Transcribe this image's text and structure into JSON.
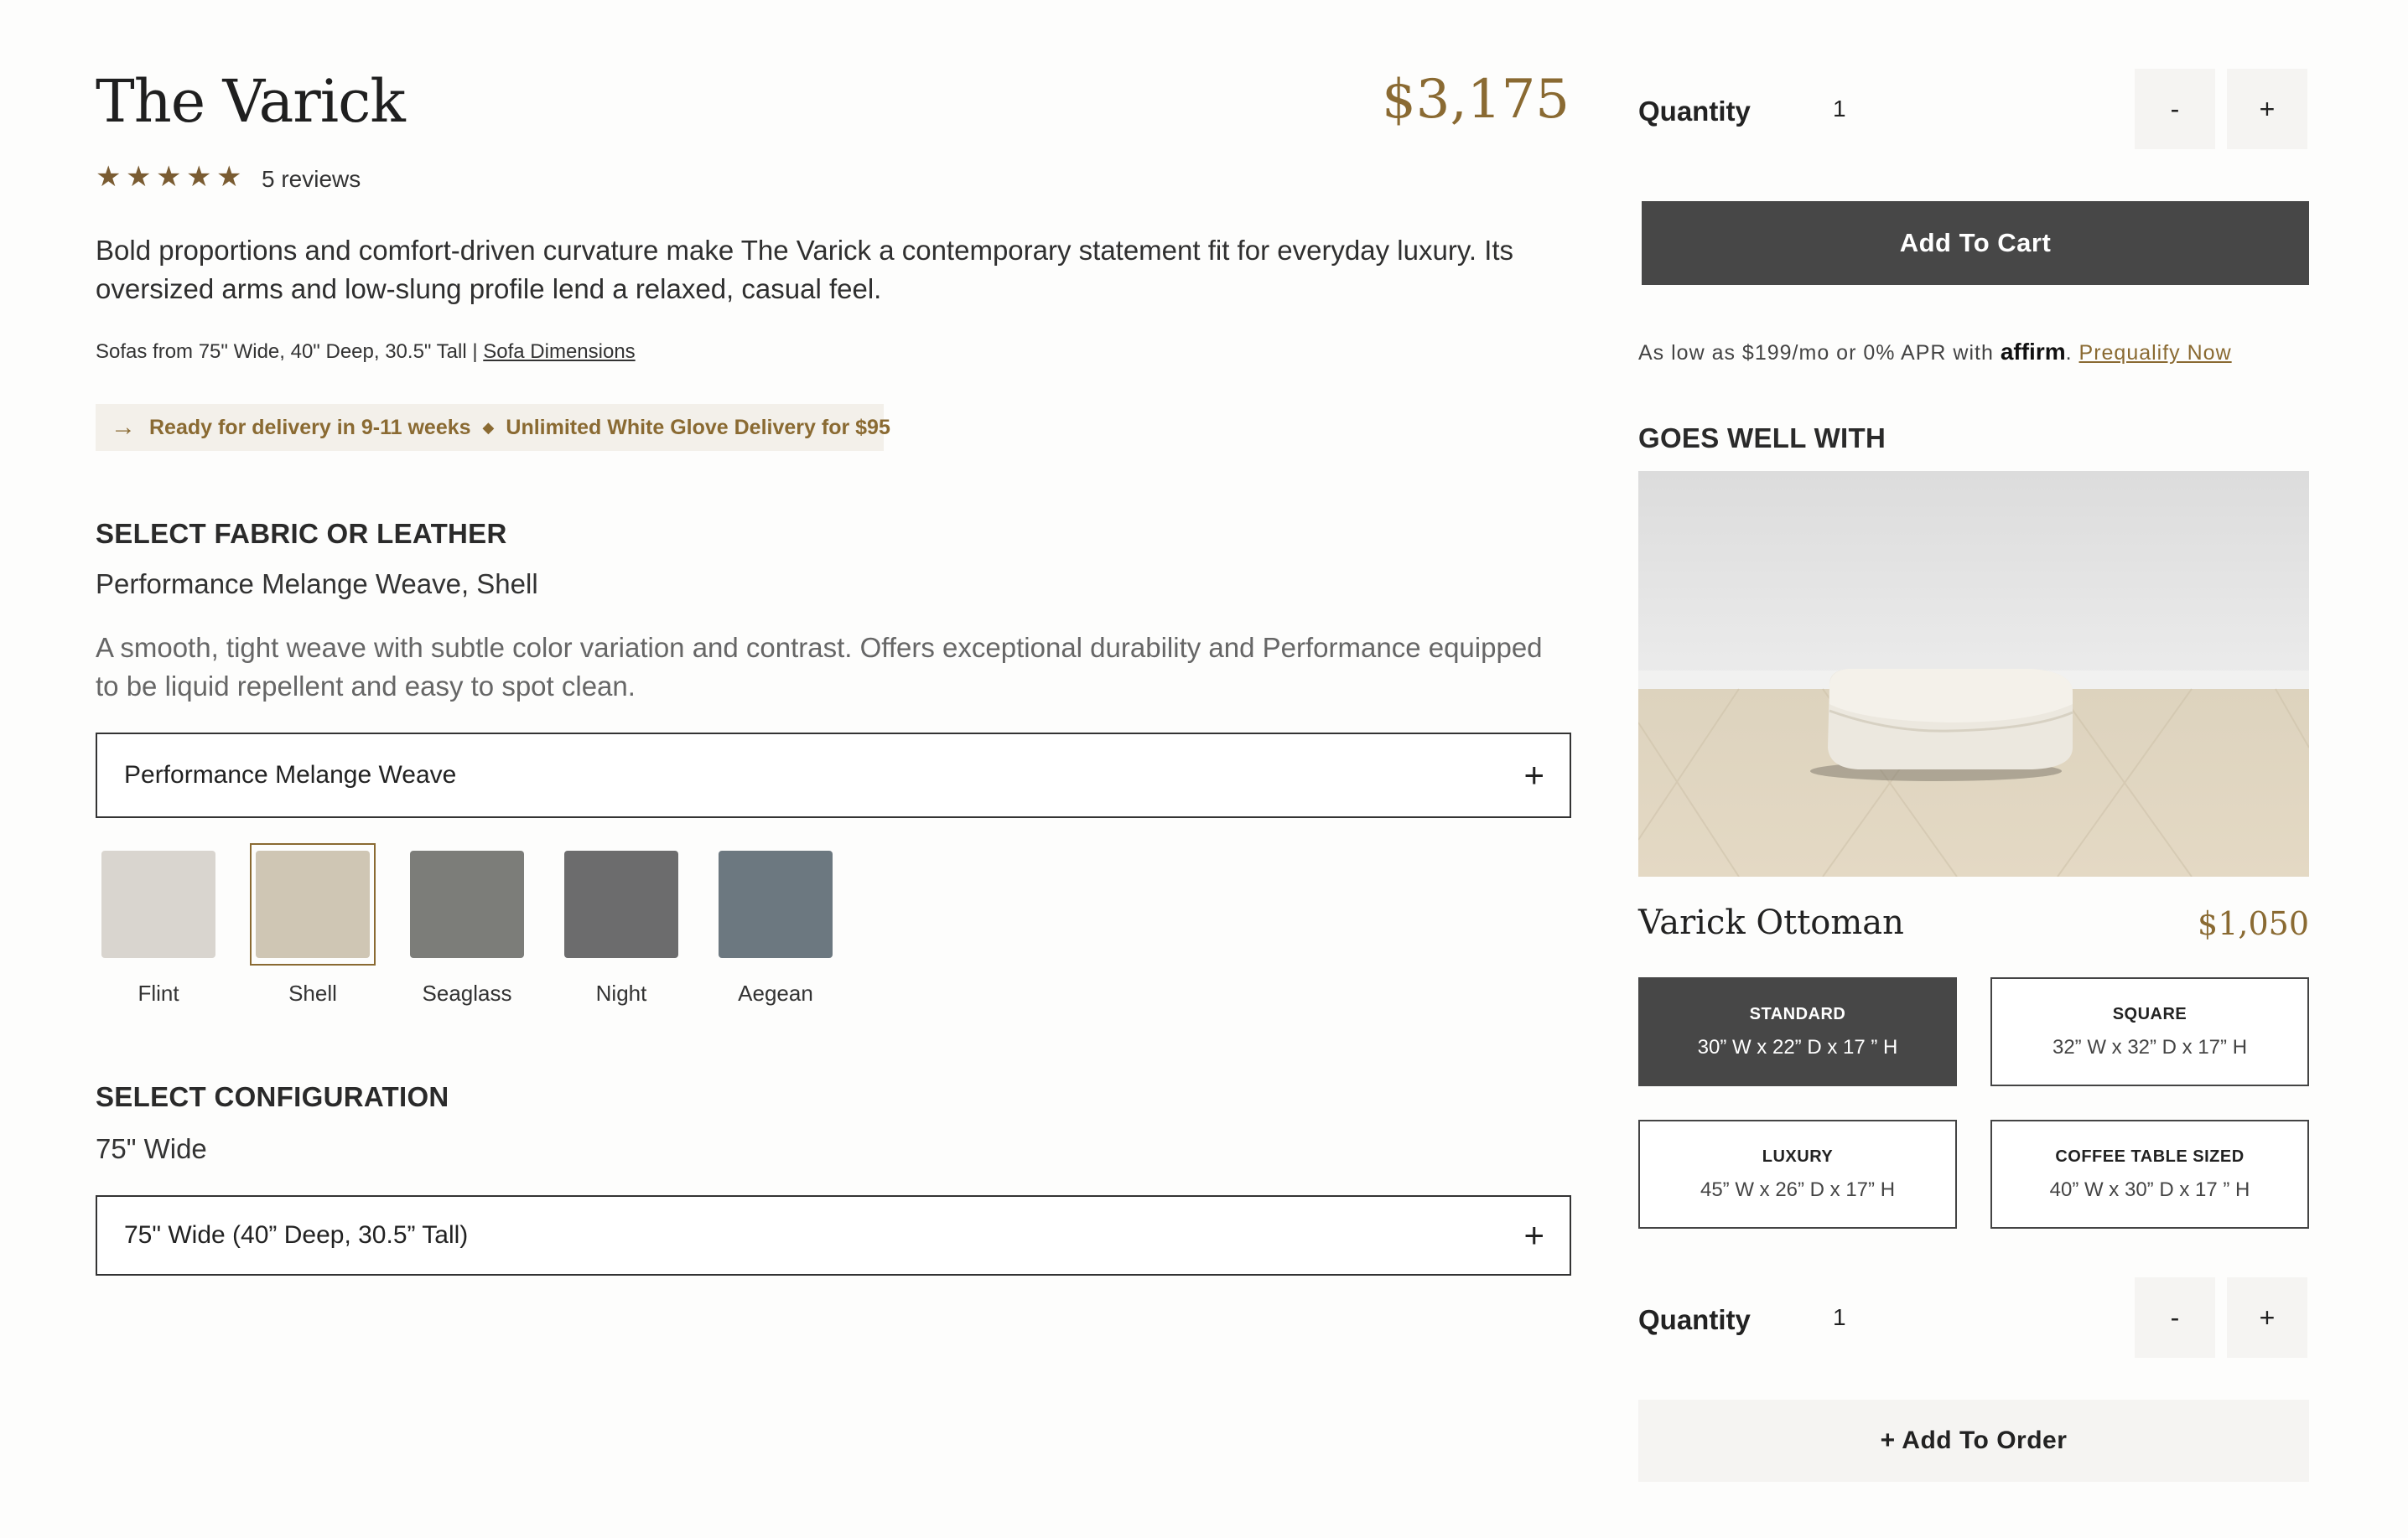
{
  "product": {
    "title": "The Varick",
    "price": "$3,175",
    "reviews": "5 reviews",
    "rating": 5,
    "description": "Bold proportions and comfort-driven curvature make The Varick a contemporary statement fit for everyday luxury. Its oversized arms and low-slung profile lend a relaxed, casual feel.",
    "dims_text": "Sofas from 75\" Wide, 40\" Deep, 30.5\" Tall |",
    "dims_link": "Sofa Dimensions",
    "delivery_ready": "Ready for delivery in 9-11 weeks",
    "delivery_glove": "Unlimited White Glove Delivery for $95"
  },
  "fabric": {
    "heading": "SELECT FABRIC OR LEATHER",
    "selected": "Performance Melange Weave, Shell",
    "description": "A smooth, tight weave with subtle color variation and contrast. Offers exceptional durability and Performance equipped to be liquid repellent and easy to spot clean.",
    "dropdown": "Performance Melange Weave",
    "swatches": [
      {
        "label": "Flint",
        "color": "#d9d5cf"
      },
      {
        "label": "Shell",
        "color": "#cfc6b4"
      },
      {
        "label": "Seaglass",
        "color": "#7c7d79"
      },
      {
        "label": "Night",
        "color": "#6c6c6d"
      },
      {
        "label": "Aegean",
        "color": "#6c7880"
      }
    ]
  },
  "config": {
    "heading": "SELECT CONFIGURATION",
    "selected": "75\" Wide",
    "dropdown": "75\" Wide (40” Deep, 30.5” Tall)"
  },
  "cart": {
    "quantity_label": "Quantity",
    "quantity": "1",
    "minus": "-",
    "plus": "+",
    "add_to_cart": "Add To Cart",
    "affirm_prefix": "As low as $199/mo or 0% APR with",
    "affirm_logo": "affirm",
    "affirm_link": "Prequalify Now"
  },
  "goes_well": {
    "heading": "GOES WELL WITH",
    "name": "Varick Ottoman",
    "price": "$1,050",
    "sizes": [
      {
        "name": "STANDARD",
        "meas": "30” W x 22” D x 17 ” H"
      },
      {
        "name": "SQUARE",
        "meas": "32” W x 32” D x 17” H"
      },
      {
        "name": "LUXURY",
        "meas": "45” W x 26” D x 17” H"
      },
      {
        "name": "COFFEE TABLE SIZED",
        "meas": "40” W x 30” D x 17 ” H"
      }
    ],
    "quantity_label": "Quantity",
    "quantity": "1",
    "minus": "-",
    "plus": "+",
    "add_to_order": "+ Add To Order"
  },
  "colors": {
    "accent": "#8a6a32",
    "dark_button": "#474747"
  }
}
